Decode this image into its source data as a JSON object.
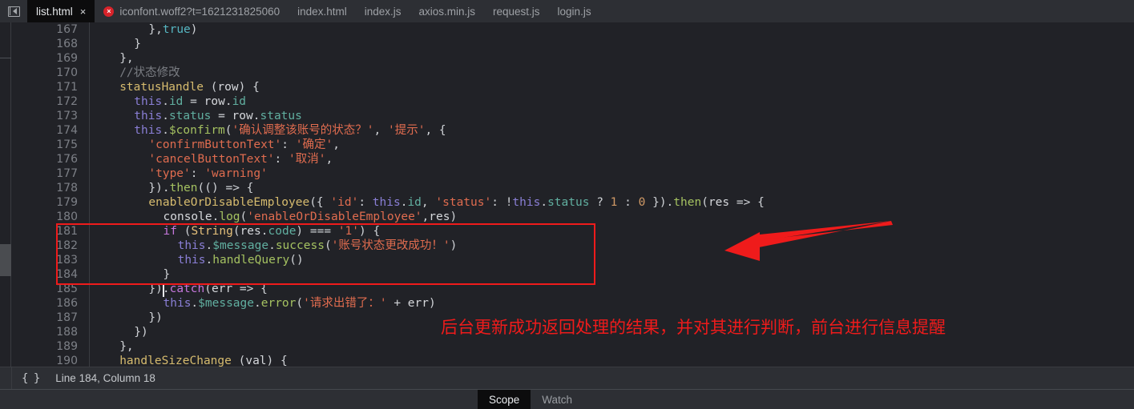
{
  "window": {
    "title": "list.html"
  },
  "tabbar": {
    "panel_toggle_title": "Toggle Panel",
    "tabs": [
      {
        "label": "list.html",
        "active": true,
        "close": "×",
        "error": false
      },
      {
        "label": "iconfont.woff2?t=1621231825060",
        "active": false,
        "close": "",
        "error": true
      },
      {
        "label": "index.html",
        "active": false,
        "close": "",
        "error": false
      },
      {
        "label": "index.js",
        "active": false,
        "close": "",
        "error": false
      },
      {
        "label": "axios.min.js",
        "active": false,
        "close": "",
        "error": false
      },
      {
        "label": "request.js",
        "active": false,
        "close": "",
        "error": false
      },
      {
        "label": "login.js",
        "active": false,
        "close": "",
        "error": false
      }
    ]
  },
  "editor": {
    "first_line": 167,
    "line_numbers": [
      167,
      168,
      169,
      170,
      171,
      172,
      173,
      174,
      175,
      176,
      177,
      178,
      179,
      180,
      181,
      182,
      183,
      184,
      185,
      186,
      187,
      188,
      189,
      190
    ],
    "lines": [
      {
        "n": 167,
        "indent": 8,
        "text": "},true)"
      },
      {
        "n": 168,
        "indent": 6,
        "text": "}"
      },
      {
        "n": 169,
        "indent": 4,
        "text": "},"
      },
      {
        "n": 170,
        "indent": 4,
        "text": "//状态修改"
      },
      {
        "n": 171,
        "indent": 4,
        "text": "statusHandle (row) {"
      },
      {
        "n": 172,
        "indent": 6,
        "text": "this.id = row.id"
      },
      {
        "n": 173,
        "indent": 6,
        "text": "this.status = row.status"
      },
      {
        "n": 174,
        "indent": 6,
        "text": "this.$confirm('确认调整该账号的状态？', '提示', {"
      },
      {
        "n": 175,
        "indent": 8,
        "text": "'confirmButtonText': '确定',"
      },
      {
        "n": 176,
        "indent": 8,
        "text": "'cancelButtonText': '取消',"
      },
      {
        "n": 177,
        "indent": 8,
        "text": "'type': 'warning'"
      },
      {
        "n": 178,
        "indent": 8,
        "text": "}).then(() => {"
      },
      {
        "n": 179,
        "indent": 8,
        "text": "enableOrDisableEmployee({ 'id': this.id, 'status': !this.status ? 1 : 0 }).then(res => {"
      },
      {
        "n": 180,
        "indent": 10,
        "text": "console.log('enableOrDisableEmployee',res)"
      },
      {
        "n": 181,
        "indent": 10,
        "text": "if (String(res.code) === '1') {"
      },
      {
        "n": 182,
        "indent": 12,
        "text": "this.$message.success('账号状态更改成功！')"
      },
      {
        "n": 183,
        "indent": 12,
        "text": "this.handleQuery()"
      },
      {
        "n": 184,
        "indent": 10,
        "text": "}"
      },
      {
        "n": 185,
        "indent": 8,
        "text": "}).catch(err => {"
      },
      {
        "n": 186,
        "indent": 10,
        "text": "this.$message.error('请求出错了：' + err)"
      },
      {
        "n": 187,
        "indent": 8,
        "text": "})"
      },
      {
        "n": 188,
        "indent": 6,
        "text": "})"
      },
      {
        "n": 189,
        "indent": 4,
        "text": "},"
      },
      {
        "n": 190,
        "indent": 4,
        "text": "handleSizeChange (val) {"
      }
    ]
  },
  "annotations": {
    "box_label": "highlighted-code-block",
    "arrow_label": "pointer-arrow",
    "note": "后台更新成功返回处理的结果，并对其进行判断，前台进行信息提醒",
    "color": "#ef1b1b"
  },
  "statusbar": {
    "brace_icon": "{ }",
    "position": "Line 184, Column 18"
  },
  "debugger": {
    "tabs": [
      {
        "label": "Scope",
        "active": true
      },
      {
        "label": "Watch",
        "active": false
      }
    ]
  }
}
